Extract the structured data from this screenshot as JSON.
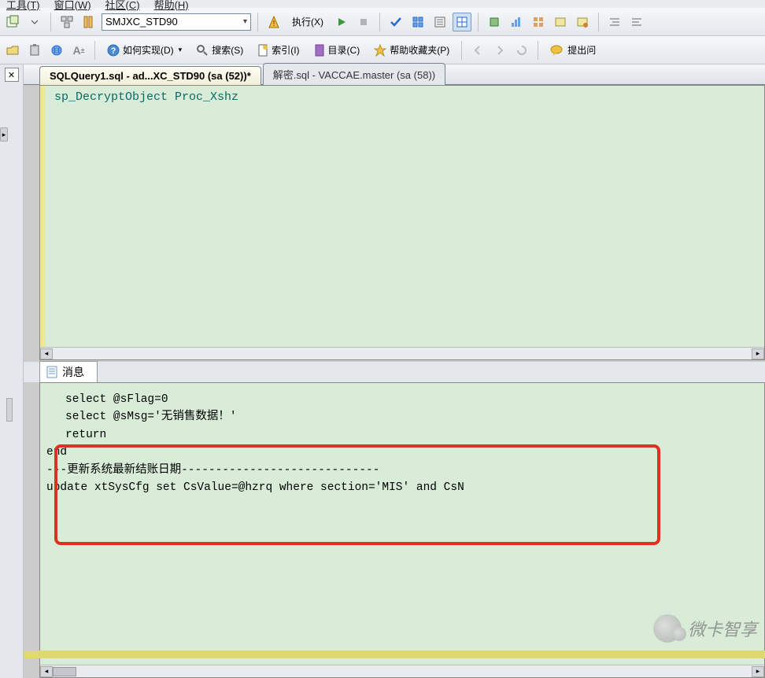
{
  "menu": {
    "tools": "工具(T)",
    "window": "窗口(W)",
    "community": "社区(C)",
    "help": "帮助(H)"
  },
  "toolbar1": {
    "db_name": "SMJXC_STD90",
    "execute": "执行(X)"
  },
  "toolbar2": {
    "howto": "如何实现(D)",
    "search": "搜索(S)",
    "index": "索引(I)",
    "contents": "目录(C)",
    "fav": "帮助收藏夹(P)",
    "ask": "提出问"
  },
  "tabs": {
    "active": "SQLQuery1.sql - ad...XC_STD90 (sa (52))*",
    "inactive": "解密.sql - VACCAE.master (sa (58))"
  },
  "editor": {
    "code": "sp_DecryptObject Proc_Xshz"
  },
  "msg": {
    "tab": "消息",
    "line1": "select @sFlag=0",
    "line2": "select @sMsg='无销售数据！'",
    "line3": "return",
    "line4": "end",
    "line5": "---更新系统最新结账日期-----------------------------",
    "line6": "update xtSysCfg set CsValue=@hzrq where section='MIS' and CsN"
  },
  "watermark": "微卡智享"
}
